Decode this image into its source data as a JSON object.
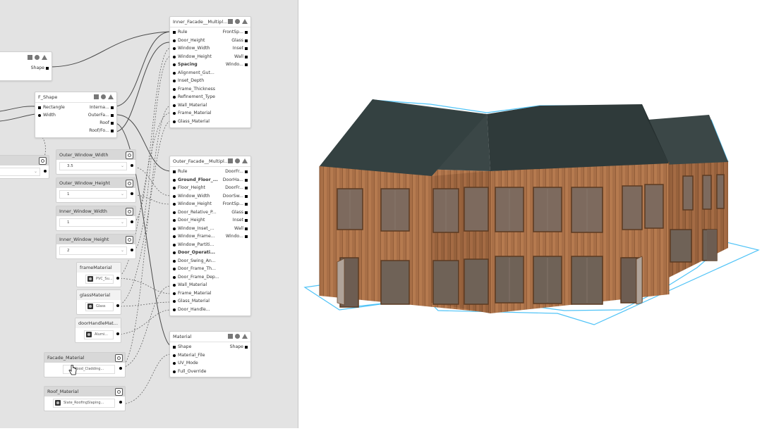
{
  "graph_nodes": {
    "shape_top": {
      "output_label": "Shape"
    },
    "f_shape": {
      "title": "F_Shape",
      "inputs": [
        "Rectangle",
        "Width"
      ],
      "outputs": [
        "Interna...",
        "OuterFa...",
        "Roof",
        "Roof/Fo..."
      ]
    },
    "inner_facade": {
      "title": "Inner_Facade__Multiple...",
      "inputs": [
        "Rule",
        "Door_Height",
        "Window_Width",
        "Window_Height",
        "Spacing",
        "Alignment_Gut...",
        "Inset_Depth",
        "Frame_Thickness",
        "Refinement_Type",
        "Wall_Material",
        "Frame_Material",
        "Glass_Material"
      ],
      "outputs": [
        "FrontSp...",
        "Glass",
        "Inset",
        "Wall",
        "Windo..."
      ]
    },
    "outer_facade": {
      "title": "Outer_Facade__Multiple...",
      "inputs": [
        "Rule",
        "Ground_Floor_...",
        "Floor_Height",
        "Window_Width",
        "Window_Height",
        "Door_Relative_P...",
        "Door_Height",
        "Window_Inset_...",
        "Window_Frame...",
        "Window_Partiti...",
        "Door_Operati...",
        "Door_Swing_An...",
        "Door_Frame_Th...",
        "Door_Frame_Dep...",
        "Wall_Material",
        "Frame_Material",
        "Glass_Material",
        "Door_Handle..."
      ],
      "outputs": [
        "DoorFr...",
        "DoorHa...",
        "DoorFr...",
        "DoorSw...",
        "FrontSp...",
        "Glass",
        "Inset",
        "Wall",
        "Windo..."
      ]
    },
    "material": {
      "title": "Material",
      "inputs": [
        "Shape",
        "Material_File",
        "UV_Mode",
        "Full_Override"
      ],
      "outputs": [
        "Shape"
      ]
    }
  },
  "params": {
    "outer_window_width": {
      "label": "Outer_Window_Width",
      "value": "3.5"
    },
    "outer_window_height": {
      "label": "Outer_Window_Height",
      "value": "1"
    },
    "inner_window_width": {
      "label": "Inner_Window_Width",
      "value": "1"
    },
    "inner_window_height": {
      "label": "Inner_Window_Height",
      "value": "2"
    },
    "frame_material": {
      "label": "frameMaterial",
      "value": "PVC_Su..."
    },
    "glass_material": {
      "label": "glassMaterial",
      "value": "Glass"
    },
    "door_handle_material": {
      "label": "doorHandleMat...",
      "value": "Alumi..."
    },
    "facade_material": {
      "label": "Facade_Material",
      "value": "Wood_Cladding..."
    },
    "roof_material": {
      "label": "Roof_Material",
      "value": "Slate_RoofingSlaping..."
    }
  },
  "icons": [
    "square-icon",
    "circle-icon",
    "triangle-icon",
    "settings-icon",
    "material-icon",
    "hand-cursor-icon"
  ],
  "colors": {
    "graph_bg": "#e3e3e3",
    "wall": "#a86f47",
    "roof": "#3b4747",
    "outline": "#4fc3f7"
  }
}
